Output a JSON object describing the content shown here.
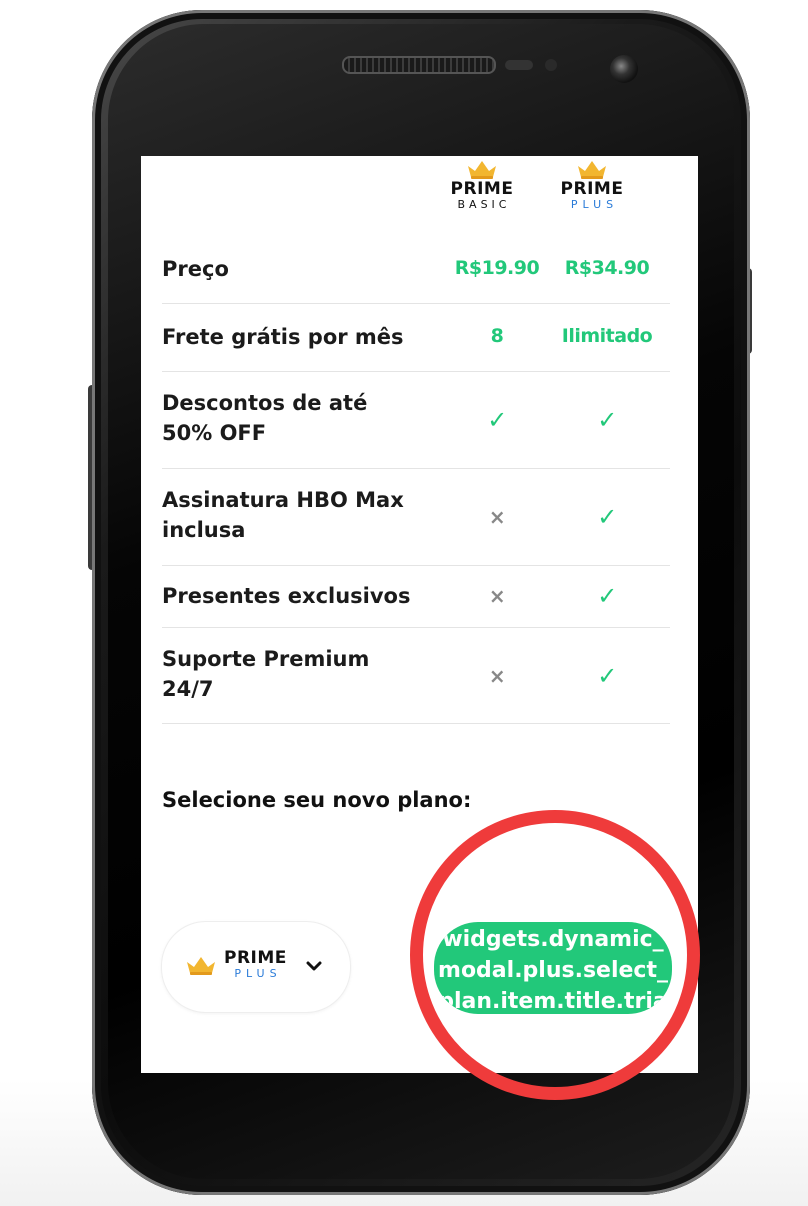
{
  "header": {
    "basic": {
      "prime": "PRIME",
      "tier": "BASIC"
    },
    "plus": {
      "prime": "PRIME",
      "tier": "PLUS"
    }
  },
  "rows": [
    {
      "label_strong": "Preço",
      "label_light": "",
      "basic": "R$19.90",
      "plus": "R$34.90"
    },
    {
      "label_strong": "Frete grátis por mês",
      "label_light": "",
      "basic": "8",
      "plus": "Ilimitado"
    },
    {
      "label_strong": "Descontos de até",
      "label_light": "50% OFF",
      "basic": "check",
      "plus": "check"
    },
    {
      "label_strong": "Assinatura HBO Max",
      "label_light": "inclusa",
      "basic": "cross",
      "plus": "check"
    },
    {
      "label_strong": "Presentes exclusivos",
      "label_light": "",
      "basic": "cross",
      "plus": "check"
    },
    {
      "label_strong": "Suporte Premium",
      "label_light": "24/7",
      "basic": "cross",
      "plus": "check"
    }
  ],
  "select": {
    "title": "Selecione seu novo plano:",
    "current_plan": {
      "prime": "PRIME",
      "tier": "PLUS"
    },
    "cta_label": "widgets.dynamic_modal.plus.select_plan.item.title.trial"
  },
  "icons": {
    "check": "✓",
    "cross": "×",
    "chevron": "chevron-down-icon",
    "crown": "crown-icon"
  },
  "colors": {
    "accent": "#22c87a",
    "plus_blue": "#2a7bd8",
    "highlight_ring": "#ef3b3b"
  }
}
